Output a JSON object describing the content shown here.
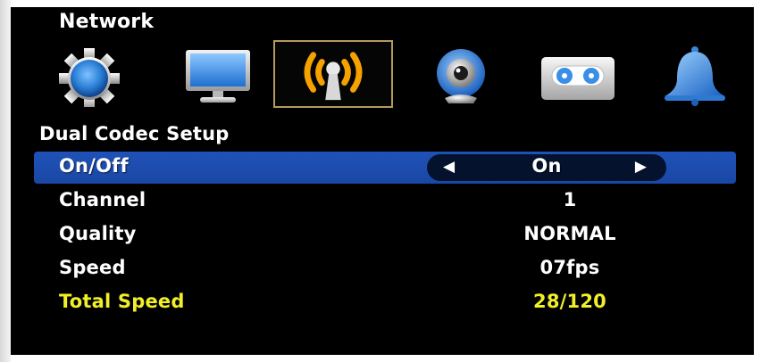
{
  "header": {
    "title": "Network"
  },
  "tabs": [
    {
      "icon": "gear-icon"
    },
    {
      "icon": "monitor-icon"
    },
    {
      "icon": "network-antenna-icon",
      "selected": true
    },
    {
      "icon": "webcam-icon"
    },
    {
      "icon": "tape-recorder-icon"
    },
    {
      "icon": "bell-icon"
    }
  ],
  "section": {
    "title": "Dual Codec Setup"
  },
  "settings": [
    {
      "label": "On/Off",
      "value": "On"
    },
    {
      "label": "Channel",
      "value": "1"
    },
    {
      "label": "Quality",
      "value": "NORMAL"
    },
    {
      "label": "Speed",
      "value": "07fps"
    },
    {
      "label": "Total Speed",
      "value": "28/120"
    }
  ],
  "colors": {
    "background": "#000000",
    "highlight_row": "#1f52b8",
    "selected_tab_border": "#b59a5b",
    "total_speed_text": "#f1ef27",
    "text": "#ffffff"
  }
}
